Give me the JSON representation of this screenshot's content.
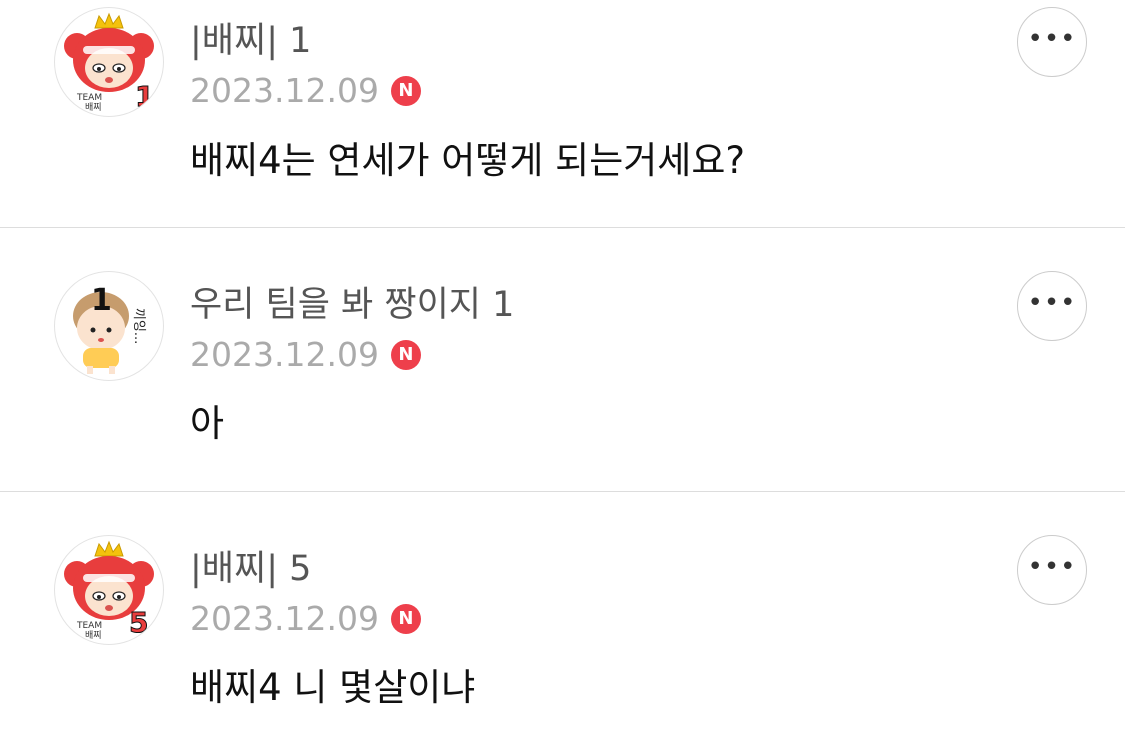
{
  "comments": [
    {
      "author": "|배찌| 1",
      "date": "2023.12.09",
      "badge": "N",
      "text": "배찌4는 연세가 어떻게 되는거세요?",
      "avatar": {
        "type": "red-bear-crown",
        "label_top": "TEAM",
        "label_bottom": "배찌",
        "number": "1"
      }
    },
    {
      "author": "우리 팀을 봐 짱이지 1",
      "date": "2023.12.09",
      "badge": "N",
      "text": "아",
      "avatar": {
        "type": "kid-yellow-shirt",
        "number": "1",
        "side_text": "끼잉..."
      }
    },
    {
      "author": "|배찌| 5",
      "date": "2023.12.09",
      "badge": "N",
      "text": "배찌4 니 몇살이냐",
      "avatar": {
        "type": "red-bear-crown",
        "label_top": "TEAM",
        "label_bottom": "배찌",
        "number": "5"
      }
    }
  ],
  "more_button_icon": "more-horizontal-icon",
  "more_button_glyph": "•••",
  "colors": {
    "badge": "#ee3f4b",
    "author": "#555555",
    "date": "#aaaaaa",
    "text": "#111111",
    "divider": "#dddddd"
  }
}
